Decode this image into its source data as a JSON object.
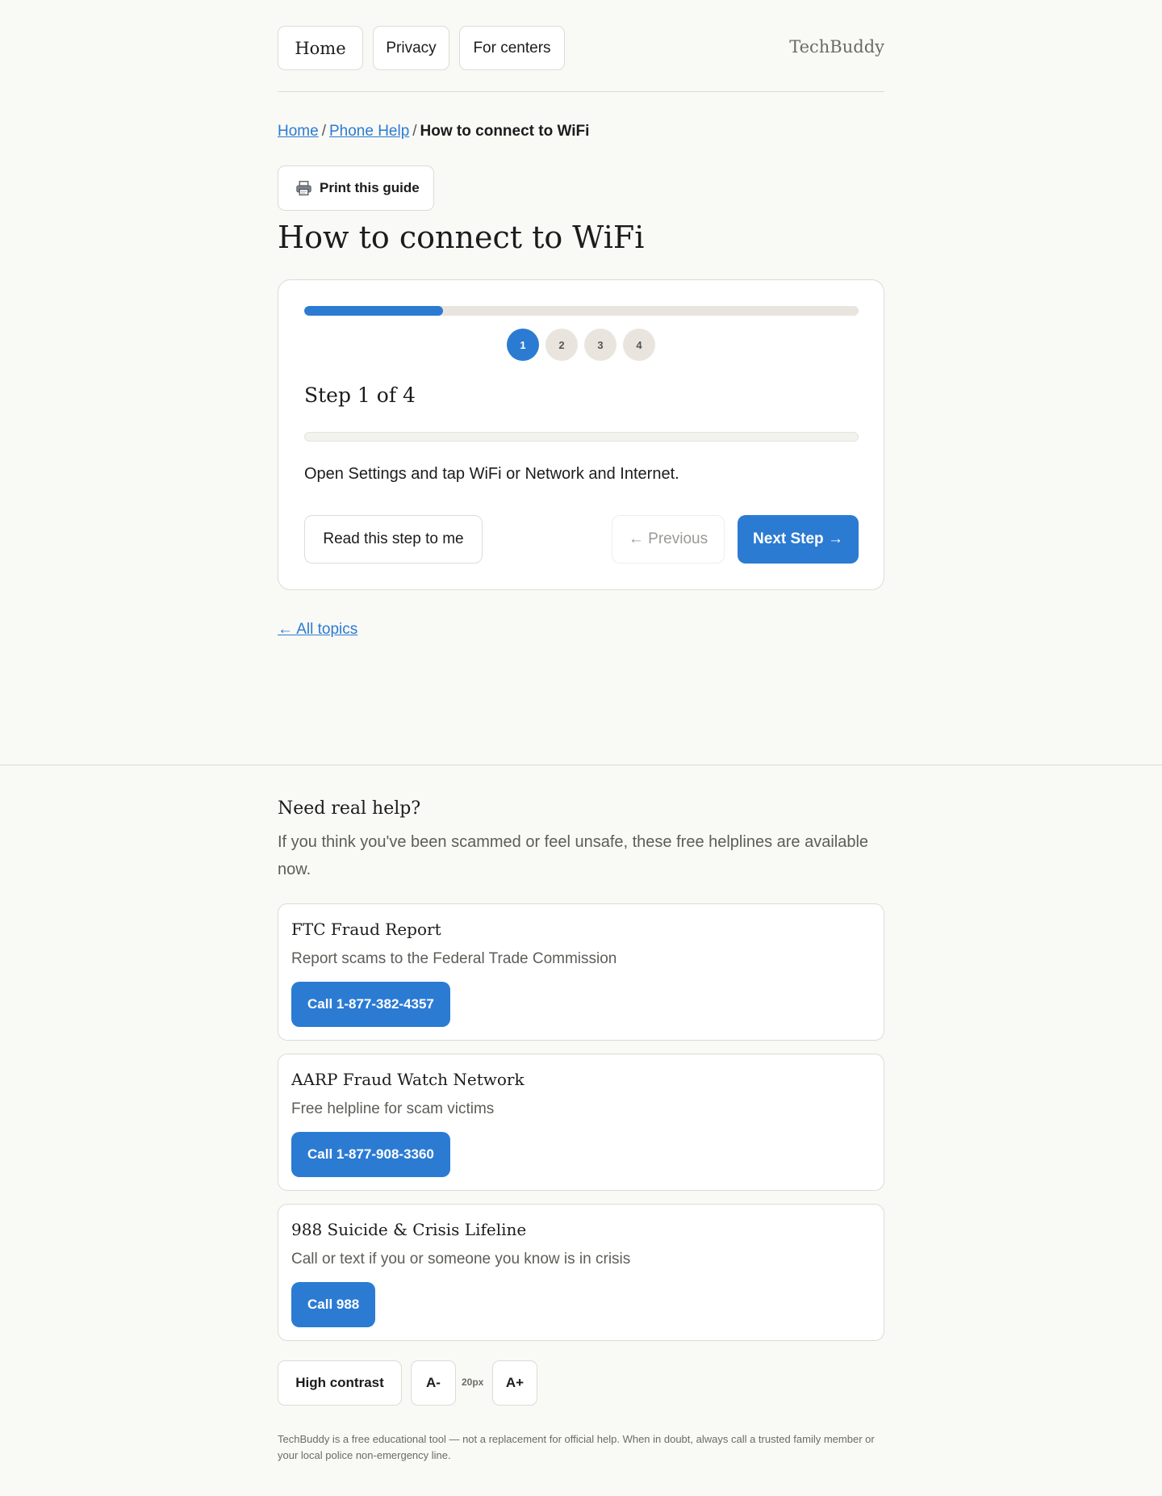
{
  "nav": {
    "home": "Home",
    "privacy": "Privacy",
    "for_centers": "For centers",
    "brand": "TechBuddy"
  },
  "breadcrumb": {
    "home": "Home",
    "section": "Phone Help",
    "current": "How to connect to WiFi",
    "separator": "/"
  },
  "print_button": {
    "label": "Print this guide",
    "icon": "printer-icon"
  },
  "page_title": "How to connect to WiFi",
  "guide": {
    "progress_fraction": 0.25,
    "steps": [
      "1",
      "2",
      "3",
      "4"
    ],
    "current_step": 1,
    "step_heading": "Step 1 of 4",
    "step_text": "Open Settings and tap WiFi or Network and Internet.",
    "read_button": "Read this step to me",
    "previous_button": "← Previous",
    "next_button": "Next Step →"
  },
  "all_topics_link": "← All topics",
  "help": {
    "title": "Need real help?",
    "intro": "If you think you've been scammed or feel unsafe, these free helplines are available now.",
    "cards": [
      {
        "title": "FTC Fraud Report",
        "desc": "Report scams to the Federal Trade Commission",
        "call": "Call 1-877-382-4357"
      },
      {
        "title": "AARP Fraud Watch Network",
        "desc": "Free helpline for scam victims",
        "call": "Call 1-877-908-3360"
      },
      {
        "title": "988 Suicide & Crisis Lifeline",
        "desc": "Call or text if you or someone you know is in crisis",
        "call": "Call 988"
      }
    ]
  },
  "accessibility": {
    "high_contrast": "High contrast",
    "decrease": "A-",
    "font_size": "20px",
    "increase": "A+"
  },
  "disclaimer": "TechBuddy is a free educational tool — not a replacement for official help. When in doubt, always call a trusted family member or your local police non-emergency line.",
  "colors": {
    "accent": "#2b7bd3",
    "background": "#f9f9f6",
    "track": "#e9e5de"
  }
}
